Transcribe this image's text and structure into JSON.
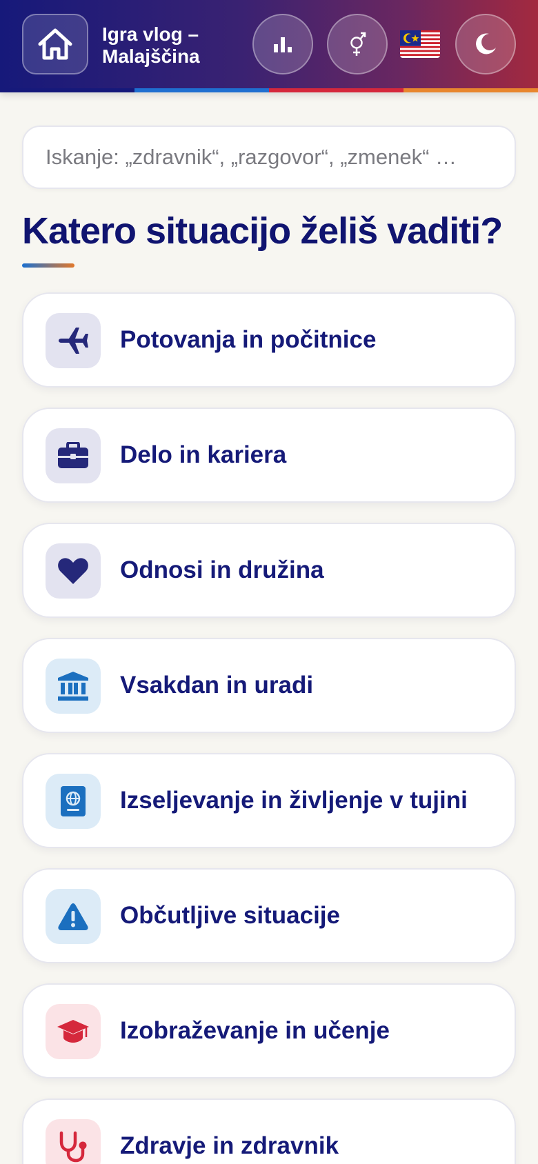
{
  "header": {
    "title": "Igra vlog – Malajščina",
    "buttons": {
      "home": "home-icon",
      "stats": "bar-chart-icon",
      "gender": "gender-icon",
      "language_flag": "malaysia-flag",
      "theme": "moon-icon"
    },
    "stripe_colors": [
      "#16197a",
      "#1f6fd0",
      "#d5283c",
      "#e8862e"
    ]
  },
  "search": {
    "placeholder": "Iskanje: „zdravnik“, „razgovor“, „zmenek“ …",
    "value": ""
  },
  "main": {
    "heading": "Katero situacijo želiš vaditi?",
    "categories": [
      {
        "label": "Potovanja in počitnice",
        "icon": "airplane-icon",
        "icon_bg": "#e3e3f0",
        "icon_color": "#25287a"
      },
      {
        "label": "Delo in kariera",
        "icon": "briefcase-icon",
        "icon_bg": "#e3e3f0",
        "icon_color": "#25287a"
      },
      {
        "label": "Odnosi in družina",
        "icon": "heart-icon",
        "icon_bg": "#e3e3f0",
        "icon_color": "#25287a"
      },
      {
        "label": "Vsakdan in uradi",
        "icon": "bank-icon",
        "icon_bg": "#dcebf7",
        "icon_color": "#1b6fbf"
      },
      {
        "label": "Izseljevanje in življenje v tujini",
        "icon": "passport-icon",
        "icon_bg": "#dcebf7",
        "icon_color": "#1b6fbf"
      },
      {
        "label": "Občutljive situacije",
        "icon": "warning-icon",
        "icon_bg": "#dcebf7",
        "icon_color": "#1b6fbf"
      },
      {
        "label": "Izobraževanje in učenje",
        "icon": "graduation-cap-icon",
        "icon_bg": "#fbe3e6",
        "icon_color": "#d5283c"
      },
      {
        "label": "Zdravje in zdravnik",
        "icon": "stethoscope-icon",
        "icon_bg": "#fbe3e6",
        "icon_color": "#d5283c"
      }
    ]
  }
}
